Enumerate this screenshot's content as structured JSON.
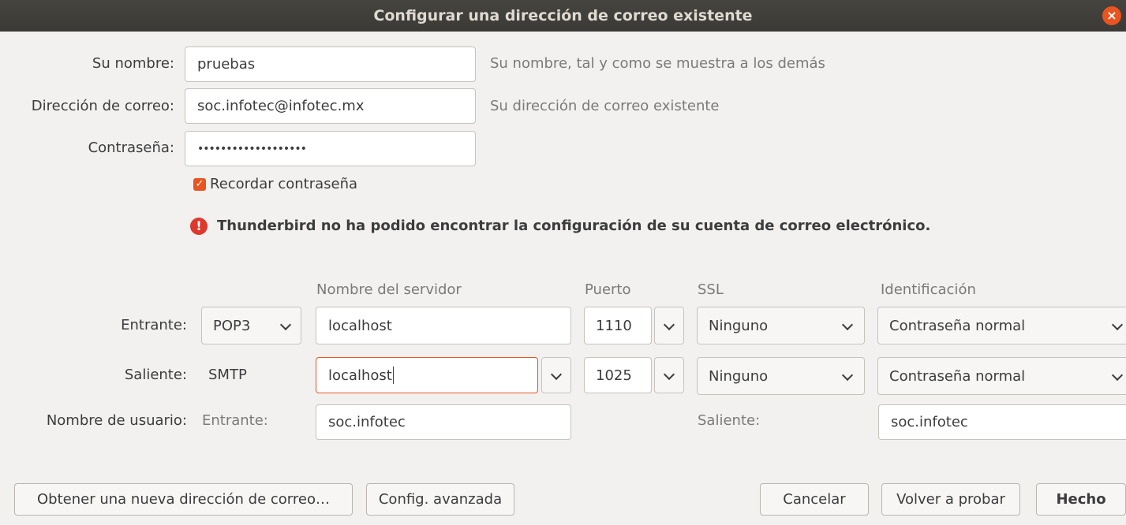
{
  "window": {
    "title": "Configurar una dirección de correo existente",
    "close_glyph": "×"
  },
  "identity": {
    "name_label": "Su nombre:",
    "name_value": "pruebas",
    "name_hint": "Su nombre, tal y como se muestra a los demás",
    "email_label": "Dirección de correo:",
    "email_value": "soc.infotec@infotec.mx",
    "email_hint": "Su dirección de correo existente",
    "password_label": "Contraseña:",
    "password_value": "•••••••••••••••••••",
    "remember_label": "Recordar contraseña",
    "remember_checked": true
  },
  "error": {
    "icon": "error-icon",
    "message": "Thunderbird no ha podido encontrar la configuración de su cuenta de correo electrónico."
  },
  "servers": {
    "headers": {
      "server": "Nombre del servidor",
      "port": "Puerto",
      "ssl": "SSL",
      "auth": "Identificación"
    },
    "incoming": {
      "label": "Entrante:",
      "protocol": "POP3",
      "hostname": "localhost",
      "port": "1110",
      "ssl": "Ninguno",
      "auth": "Contraseña normal"
    },
    "outgoing": {
      "label": "Saliente:",
      "protocol": "SMTP",
      "hostname": "localhost",
      "port": "1025",
      "ssl": "Ninguno",
      "auth": "Contraseña normal"
    },
    "username": {
      "label": "Nombre de usuario:",
      "incoming_label": "Entrante:",
      "incoming_value": "soc.infotec",
      "outgoing_label": "Saliente:",
      "outgoing_value": "soc.infotec"
    }
  },
  "buttons": {
    "new_address": "Obtener una nueva dirección de correo…",
    "advanced": "Config. avanzada",
    "cancel": "Cancelar",
    "retest": "Volver a probar",
    "done": "Hecho"
  },
  "colors": {
    "accent": "#e95420",
    "error": "#df382c",
    "titlebar": "#3e3d39"
  }
}
